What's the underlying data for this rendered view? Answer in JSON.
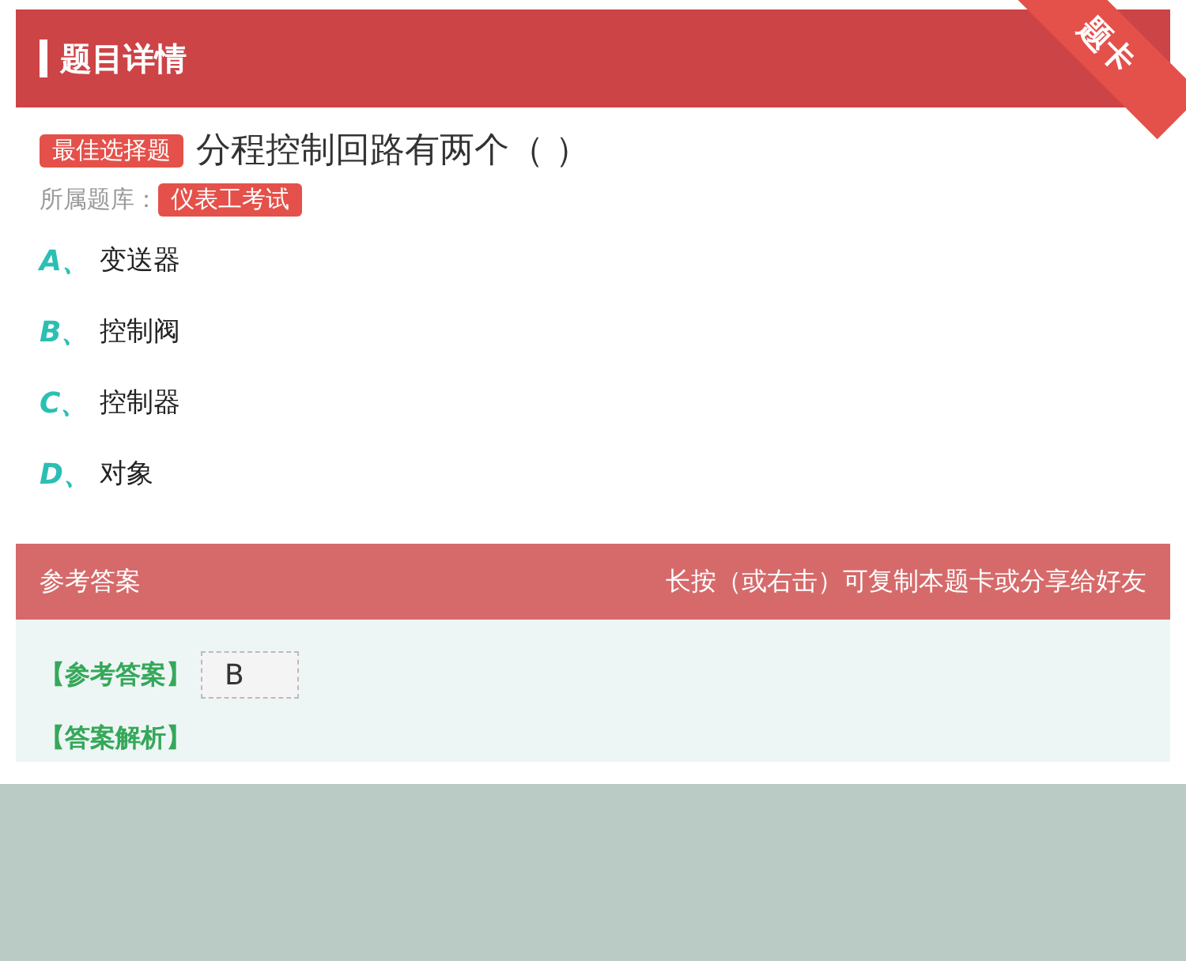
{
  "header": {
    "title": "题目详情",
    "ribbon": "题卡"
  },
  "question": {
    "type_tag": "最佳选择题",
    "text": "分程控制回路有两个（  ）",
    "bank_label": "所属题库：",
    "bank": "仪表工考试"
  },
  "options": [
    {
      "letter": "A、",
      "text": "变送器"
    },
    {
      "letter": "B、",
      "text": "控制阀"
    },
    {
      "letter": "C、",
      "text": "控制器"
    },
    {
      "letter": "D、",
      "text": "对象"
    }
  ],
  "answer": {
    "title": "参考答案",
    "hint": "长按（或右击）可复制本题卡或分享给好友",
    "answer_label": "【参考答案】",
    "answer_value": "B",
    "analysis_label": "【答案解析】"
  }
}
